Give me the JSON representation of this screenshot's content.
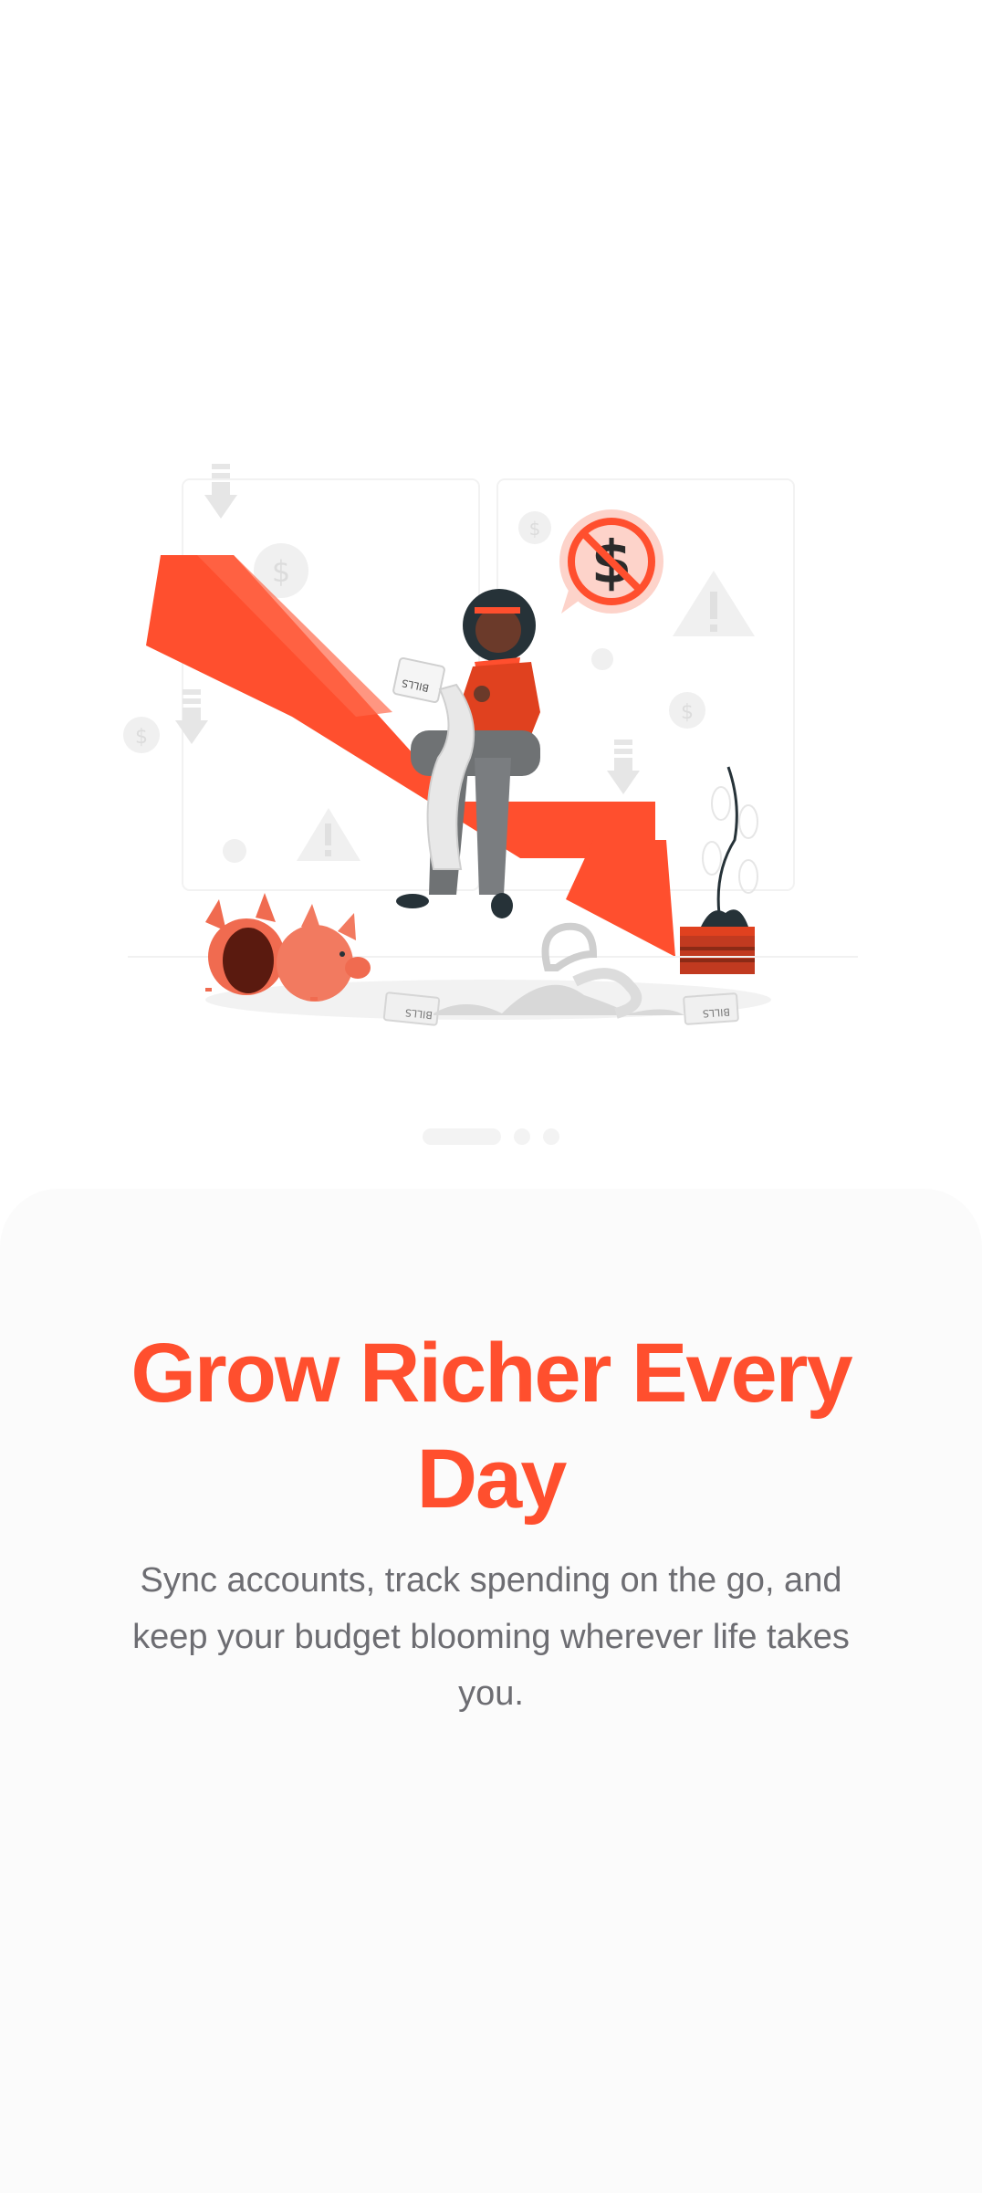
{
  "illustration": {
    "bills_label": "BILLS",
    "icons": [
      "down-arrow-icon",
      "dollar-coin-icon",
      "warning-icon",
      "no-dollar-icon",
      "piggy-bank-icon",
      "potted-plant-icon"
    ]
  },
  "pager": {
    "pages": 3,
    "active_index": 0
  },
  "onboarding": {
    "title": "Grow Richer Every Day",
    "subtitle": "Sync accounts, track spending on the go, and keep your budget blooming wherever life takes you."
  },
  "colors": {
    "accent": "#ff4f2e",
    "text_secondary": "#6d6d72",
    "sheet_background": "#fbfbfb",
    "page_background": "#ffffff"
  }
}
